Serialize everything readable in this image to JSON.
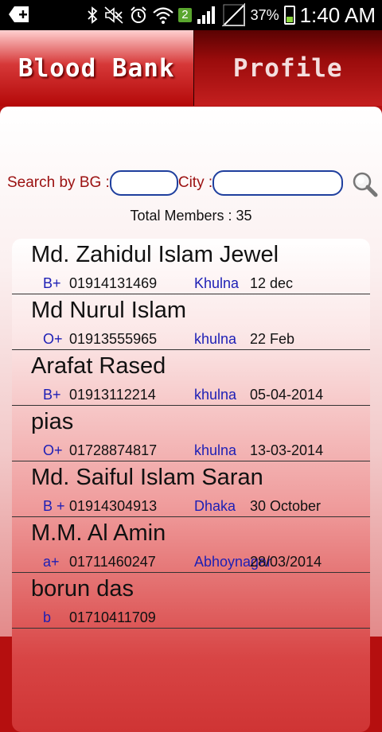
{
  "status_bar": {
    "time": "1:40 AM",
    "battery_percent": "37%",
    "notification_count": "2",
    "icons": [
      "add-notification-icon",
      "bluetooth-icon",
      "mute-icon",
      "alarm-icon",
      "wifi-icon",
      "signal-icon",
      "battery-icon"
    ]
  },
  "tabs": [
    {
      "label": "Blood Bank",
      "active": true
    },
    {
      "label": "Profile",
      "active": false
    }
  ],
  "search": {
    "bg_label": "Search by BG :",
    "bg_value": "",
    "city_label": "City :",
    "city_value": ""
  },
  "total_members": "Total Members : 35",
  "members": [
    {
      "name": "Md. Zahidul Islam Jewel",
      "blood_group": "B+",
      "phone": "01914131469",
      "city": "Khulna",
      "date": "12 dec"
    },
    {
      "name": "Md Nurul Islam",
      "blood_group": "O+",
      "phone": "01913555965",
      "city": "khulna",
      "date": "22 Feb"
    },
    {
      "name": "Arafat Rased",
      "blood_group": "B+",
      "phone": "01913112214",
      "city": "khulna",
      "date": "05-04-2014"
    },
    {
      "name": "pias",
      "blood_group": "O+",
      "phone": "01728874817",
      "city": "khulna",
      "date": "13-03-2014"
    },
    {
      "name": "Md. Saiful Islam Saran",
      "blood_group": "B +",
      "phone": "01914304913",
      "city": "Dhaka",
      "date": "30 October"
    },
    {
      "name": "M.M. Al Amin",
      "blood_group": "a+",
      "phone": "01711460247",
      "city": "Abhoynagar",
      "date": "28/03/2014"
    },
    {
      "name": "borun das",
      "blood_group": "b",
      "phone": "01710411709",
      "city": "",
      "date": ""
    }
  ]
}
